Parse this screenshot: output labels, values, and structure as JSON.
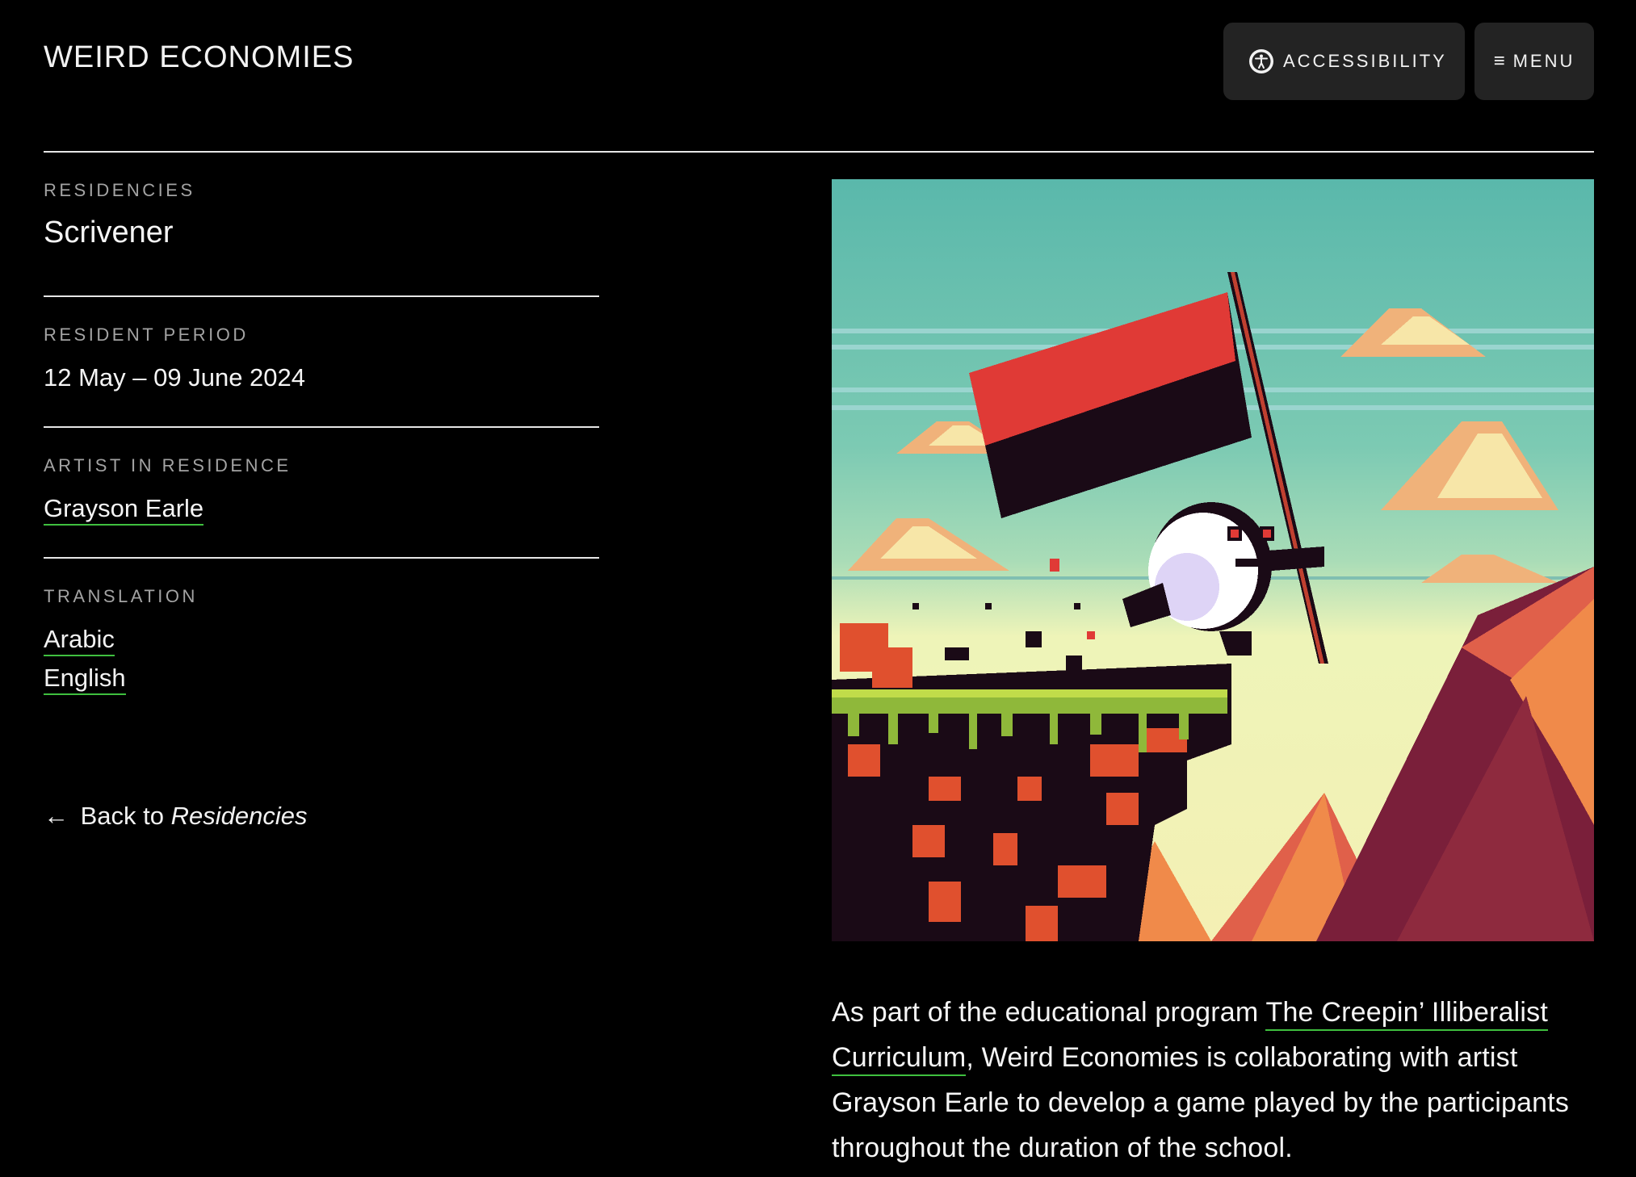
{
  "site": {
    "logo": "WEIRD ECONOMIES"
  },
  "header": {
    "accessibility_label": "ACCESSIBILITY",
    "menu_label": "MENU",
    "menu_icon": "≡"
  },
  "sections": {
    "category_label": "RESIDENCIES",
    "title": "Scrivener",
    "period_label": "RESIDENT PERIOD",
    "period_value": "12 May – 09 June 2024",
    "artist_label": "ARTIST IN RESIDENCE",
    "artist_value": "Grayson Earle",
    "translation_label": "TRANSLATION",
    "translations": [
      "Arabic",
      "English"
    ]
  },
  "back": {
    "prefix": "Back to",
    "target": "Residencies",
    "arrow": "←"
  },
  "description": {
    "before": "As part of the educational program ",
    "link": "The Creepin’ Illiberalist Curriculum",
    "after": ", Weird Economies is collaborating with artist Grayson Earle to develop a game played by the participants throughout the duration of the school."
  },
  "colors": {
    "background": "#000000",
    "link_underline": "#3fbf3f",
    "button_bg": "#232323"
  }
}
